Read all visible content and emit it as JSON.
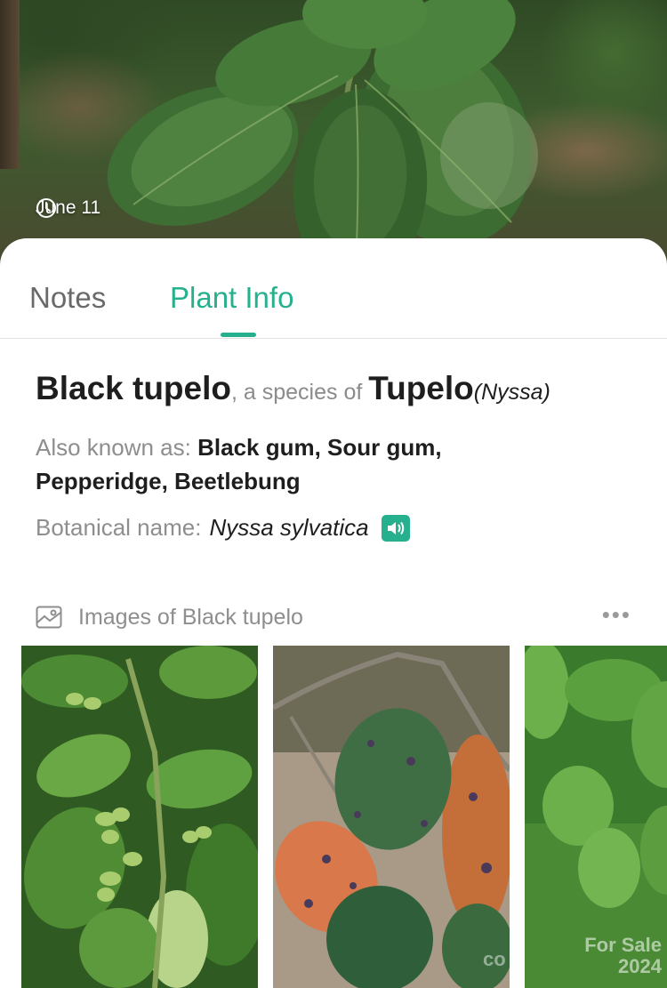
{
  "hero": {
    "date": "June 11",
    "clock_icon": "clock-icon"
  },
  "tabs": [
    {
      "label": "Notes",
      "active": false
    },
    {
      "label": "Plant Info",
      "active": true
    }
  ],
  "accent_color": "#27b08e",
  "plant": {
    "common_name": "Black tupelo",
    "connector": ", a species of ",
    "genus_common": "Tupelo",
    "genus_latin": "(Nyssa)",
    "also_known_label": "Also known as:",
    "also_known_value": "Black gum, Sour gum, Pepperidge, Beetlebung",
    "botanical_label": "Botanical name:",
    "botanical_value": "Nyssa sylvatica",
    "speaker_icon": "speaker-icon"
  },
  "images": {
    "header_icon": "image-gallery-icon",
    "title": "Images of Black tupelo",
    "more_label": "•••",
    "watermark_line1": "For Sale",
    "watermark_line2": "2024",
    "watermark_prefix": "co"
  }
}
